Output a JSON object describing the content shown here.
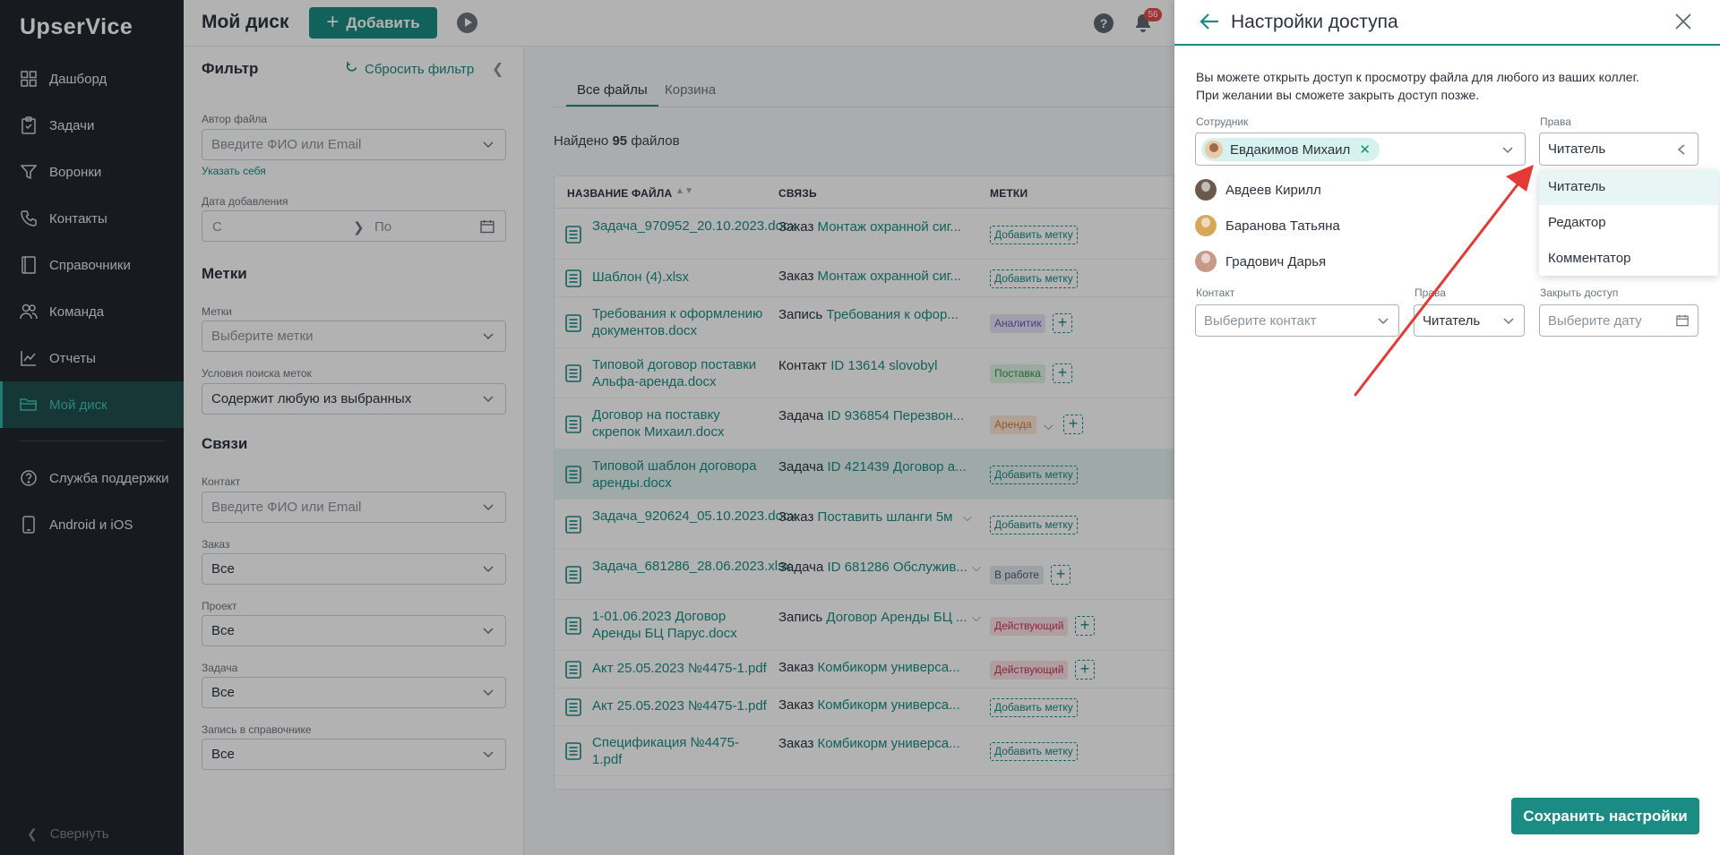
{
  "app": {
    "logo": "UpserVice"
  },
  "sidebar": {
    "items": [
      {
        "label": "Дашборд",
        "icon": "dashboard-icon"
      },
      {
        "label": "Задачи",
        "icon": "tasks-icon"
      },
      {
        "label": "Воронки",
        "icon": "funnel-icon"
      },
      {
        "label": "Контакты",
        "icon": "phone-icon"
      },
      {
        "label": "Справочники",
        "icon": "book-icon"
      },
      {
        "label": "Команда",
        "icon": "team-icon"
      },
      {
        "label": "Отчеты",
        "icon": "chart-icon"
      },
      {
        "label": "Мой диск",
        "icon": "folder-icon",
        "active": true
      }
    ],
    "bottom_items": [
      {
        "label": "Служба поддержки",
        "icon": "help-icon"
      },
      {
        "label": "Android и iOS",
        "icon": "mobile-icon"
      }
    ],
    "collapse_label": "Свернуть"
  },
  "header": {
    "title": "Мой диск",
    "add_label": "Добавить",
    "help": "?",
    "notifications_count": "56"
  },
  "filter": {
    "title": "Фильтр",
    "reset_label": "Сбросить фильтр",
    "author_label": "Автор файла",
    "author_placeholder": "Введите ФИО или Email",
    "self_link": "Указать себя",
    "date_label": "Дата добавления",
    "date_from": "С",
    "date_to": "По",
    "tags_heading": "Метки",
    "tags_label": "Метки",
    "tags_placeholder": "Выберите метки",
    "tag_cond_label": "Условия поиска меток",
    "tag_cond_value": "Содержит любую из выбранных",
    "links_heading": "Связи",
    "contact_label": "Контакт",
    "contact_placeholder": "Введите ФИО или Email",
    "order_label": "Заказ",
    "order_value": "Все",
    "project_label": "Проект",
    "project_value": "Все",
    "task_label": "Задача",
    "task_value": "Все",
    "record_label": "Запись в справочнике",
    "record_value": "Все"
  },
  "main": {
    "tabs": [
      "Все файлы",
      "Корзина"
    ],
    "found_prefix": "Найдено",
    "found_count": "95",
    "found_suffix": "файлов",
    "columns": [
      "НАЗВАНИЕ ФАЙЛА",
      "СВЯЗЬ",
      "МЕТКИ"
    ],
    "rows": [
      {
        "name": "Задача_970952_20.10.2023.docx",
        "rel_type": "Заказ",
        "rel_value": "Монтаж охранной сиг...",
        "tag": "Добавить метку",
        "tag_style": "add"
      },
      {
        "name": "Шаблон (4).xlsx",
        "rel_type": "Заказ",
        "rel_value": "Монтаж охранной сиг...",
        "tag": "Добавить метку",
        "tag_style": "add"
      },
      {
        "name": "Требования к оформлению документов.docx",
        "rel_type": "Запись",
        "rel_value": "Требования к офор...",
        "tag": "Аналитик",
        "tag_style": "analyst"
      },
      {
        "name": "Типовой договор поставки Альфа-аренда.docx",
        "rel_type": "Контакт",
        "rel_value": "ID 13614 slovobyl",
        "tag": "Поставка",
        "tag_style": "supply"
      },
      {
        "name": "Договор на поставку скрепок Михаил.docx",
        "rel_type": "Задача",
        "rel_value": "ID 936854 Перезвон...",
        "tag": "Аренда",
        "tag_style": "rent"
      },
      {
        "name": "Типовой шаблон договора аренды.docx",
        "rel_type": "Задача",
        "rel_value": "ID 421439 Договор а...",
        "tag": "Добавить метку",
        "tag_style": "add"
      },
      {
        "name": "Задача_920624_05.10.2023.docx",
        "rel_type": "Заказ",
        "rel_value": "Поставить шланги 5м",
        "tag": "Добавить метку",
        "tag_style": "add"
      },
      {
        "name": "Задача_681286_28.06.2023.xlsx",
        "rel_type": "Задача",
        "rel_value": "ID 681286 Обслужив...",
        "tag": "В работе",
        "tag_style": "work"
      },
      {
        "name": "1-01.06.2023 Договор Аренды БЦ Парус.docx",
        "rel_type": "Запись",
        "rel_value": "Договор Аренды БЦ ...",
        "tag": "Действующий",
        "tag_style": "active"
      },
      {
        "name": "Акт 25.05.2023 №4475-1.pdf",
        "rel_type": "Заказ",
        "rel_value": "Комбикорм универса...",
        "tag": "Действующий",
        "tag_style": "active"
      },
      {
        "name": "Акт 25.05.2023 №4475-1.pdf",
        "rel_type": "Заказ",
        "rel_value": "Комбикорм универса...",
        "tag": "Добавить метку",
        "tag_style": "add"
      },
      {
        "name": "Спецификация №4475-1.pdf",
        "rel_type": "Заказ",
        "rel_value": "Комбикорм универса...",
        "tag": "Добавить метку",
        "tag_style": "add"
      }
    ]
  },
  "drawer": {
    "title": "Настройки доступа",
    "info_line1": "Вы можете открыть доступ к просмотру файла для любого из ваших коллег.",
    "info_line2": "При желании вы сможете закрыть доступ позже.",
    "employee_label": "Сотрудник",
    "employee_chip": "Евдакимов Михаил",
    "rights_label": "Права",
    "rights_value": "Читатель",
    "employees": [
      "Авдеев Кирилл",
      "Баранова Татьяна",
      "Градович Дарья"
    ],
    "rights_options": [
      "Читатель",
      "Редактор",
      "Комментатор"
    ],
    "contact_label": "Контакт",
    "contact_placeholder": "Выберите контакт",
    "contact_rights_label": "Права",
    "contact_rights_value": "Читатель",
    "close_access_label": "Закрыть доступ",
    "close_access_placeholder": "Выберите дату",
    "save_label": "Сохранить настройки"
  },
  "colors": {
    "accent": "#1a8c83",
    "sidebar_bg": "#21272e",
    "annotation_arrow": "#e53935"
  }
}
